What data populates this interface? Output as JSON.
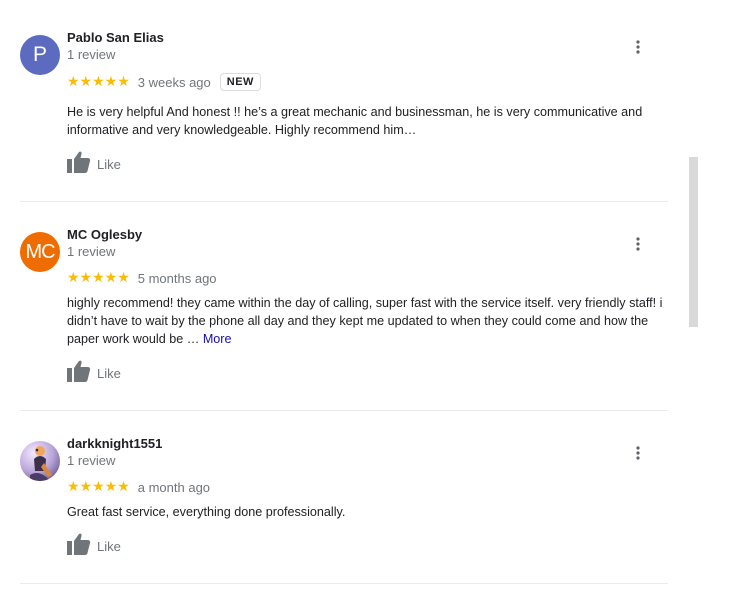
{
  "reviews": [
    {
      "avatar_letter": "P",
      "name": "Pablo San Elias",
      "review_count": "1 review",
      "rating_stars": "★★★★★",
      "rating": 5,
      "time_ago": "3 weeks ago",
      "badge": "NEW",
      "text": "He is very helpful And honest !! he’s a great mechanic and businessman, he is very communicative  and informative and very knowledgeable. Highly recommend him…",
      "more_label": "",
      "like_label": "Like"
    },
    {
      "avatar_letter": "MC",
      "name": "MC Oglesby",
      "review_count": "1 review",
      "rating_stars": "★★★★★",
      "rating": 5,
      "time_ago": "5 months ago",
      "badge": "",
      "text": "highly recommend! they came within the day of calling, super fast with the service itself. very friendly staff! i didn’t have to wait by the phone all day and they kept me updated to when they could come and how the paper work would be … ",
      "more_label": "More",
      "like_label": "Like"
    },
    {
      "avatar_letter": "",
      "name": "darkknight1551",
      "review_count": "1 review",
      "rating_stars": "★★★★★",
      "rating": 5,
      "time_ago": "a month ago",
      "badge": "",
      "text": "Great fast service, everything done professionally.",
      "more_label": "",
      "like_label": "Like"
    }
  ],
  "colors": {
    "star": "#fbbc04",
    "avatar_p": "#5c6bc0",
    "avatar_mc": "#ef6c00",
    "more_link": "#1a0dab",
    "secondary_text": "#70757a"
  },
  "icons": {
    "like": "thumbs-up-icon",
    "menu": "more-vert-icon"
  }
}
